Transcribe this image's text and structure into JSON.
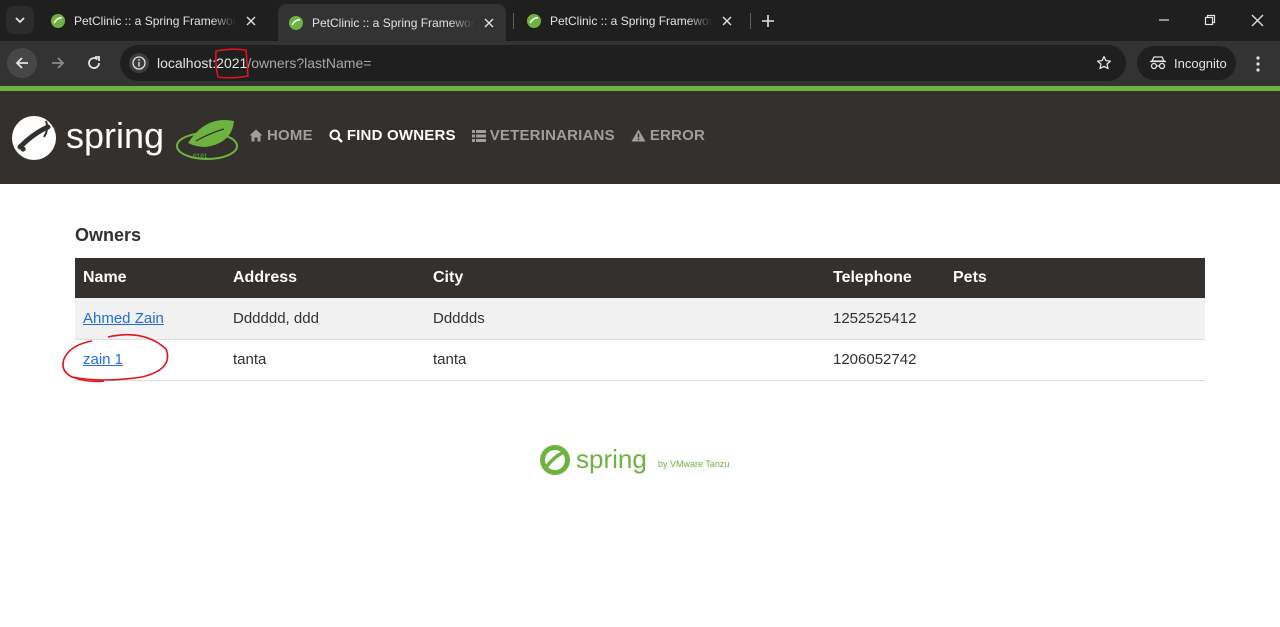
{
  "browser": {
    "tabs": [
      {
        "title": "PetClinic :: a Spring Framework",
        "active": false
      },
      {
        "title": "PetClinic :: a Spring Framework",
        "active": true
      },
      {
        "title": "PetClinic :: a Spring Framework",
        "active": false
      }
    ],
    "url_host": "localhost:",
    "url_port": "2021",
    "url_path": "/owners?lastName=",
    "incognito_label": "Incognito"
  },
  "navbar": {
    "brand": "spring",
    "items": [
      {
        "label": "HOME",
        "icon": "home-icon",
        "active": false
      },
      {
        "label": "FIND OWNERS",
        "icon": "search-icon",
        "active": true
      },
      {
        "label": "VETERINARIANS",
        "icon": "list-icon",
        "active": false
      },
      {
        "label": "ERROR",
        "icon": "warning-icon",
        "active": false
      }
    ]
  },
  "main": {
    "title": "Owners",
    "columns": [
      "Name",
      "Address",
      "City",
      "Telephone",
      "Pets"
    ],
    "rows": [
      {
        "name": "Ahmed Zain",
        "address": "Dddddd, ddd",
        "city": "Ddddds",
        "telephone": "1252525412",
        "pets": ""
      },
      {
        "name": "zain 1",
        "address": "tanta",
        "city": "tanta",
        "telephone": "1206052742",
        "pets": ""
      }
    ]
  },
  "footer": {
    "brand": "spring",
    "byline": "by VMware Tanzu"
  },
  "colors": {
    "spring_green": "#6db33f",
    "nav_dark": "#34302d",
    "link": "#1f6fd6",
    "annotation_red": "#e0141e"
  }
}
